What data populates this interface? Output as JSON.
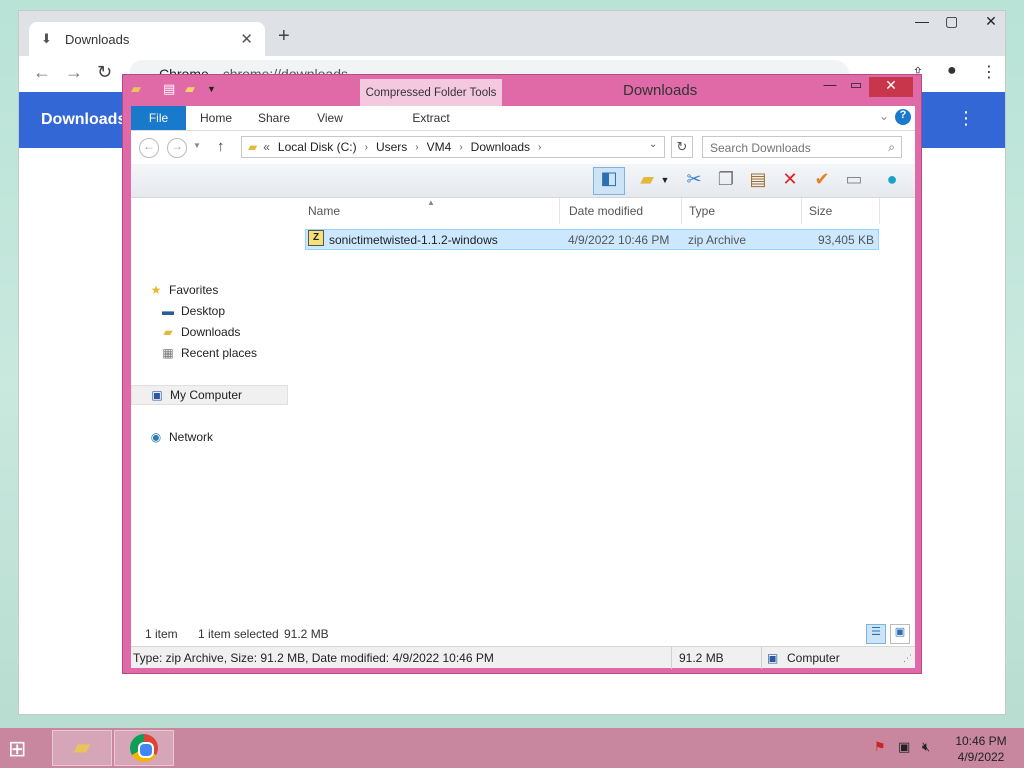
{
  "chrome": {
    "tab_title": "Downloads",
    "omnibox_host": "Chrome",
    "omnibox_url": "chrome://downloads",
    "page_title": "Downloads"
  },
  "explorer": {
    "title": "Downloads",
    "context_tab": "Compressed Folder Tools",
    "ribbon_tabs": [
      "File",
      "Home",
      "Share",
      "View",
      "Extract"
    ],
    "breadcrumb": [
      "Local Disk (C:)",
      "Users",
      "VM4",
      "Downloads"
    ],
    "breadcrumb_prefix": "«",
    "search_placeholder": "Search Downloads",
    "nav": {
      "favorites": "Favorites",
      "desktop": "Desktop",
      "downloads": "Downloads",
      "recent": "Recent places",
      "computer": "My Computer",
      "network": "Network"
    },
    "columns": [
      "Name",
      "Date modified",
      "Type",
      "Size"
    ],
    "files": [
      {
        "name": "sonictimetwisted-1.1.2-windows",
        "date": "4/9/2022 10:46 PM",
        "type": "zip Archive",
        "size": "93,405 KB"
      }
    ],
    "status": {
      "count": "1 item",
      "selected": "1 item selected",
      "selected_size": "91.2 MB"
    },
    "details": {
      "summary": "Type: zip Archive, Size: 91.2 MB, Date modified: 4/9/2022 10:46 PM",
      "size": "91.2 MB",
      "location": "Computer"
    }
  },
  "taskbar": {
    "time": "10:46 PM",
    "date": "4/9/2022"
  },
  "icons": {
    "favorites": "star-icon",
    "desktop": "desktop-icon",
    "downloads": "folder-icon",
    "recent": "recent-places-icon",
    "computer": "computer-icon",
    "network": "network-icon",
    "file": "zip-archive-icon"
  },
  "colors": {
    "chrome_header": "#3367d6",
    "explorer_frame": "#e06aa8",
    "file_tab": "#1979ca",
    "selection": "#cce8ff",
    "taskbar": "#c8879f"
  }
}
